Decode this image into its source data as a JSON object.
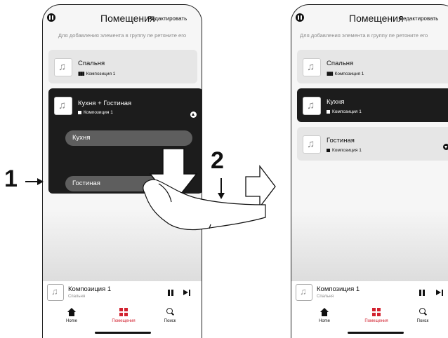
{
  "header": {
    "title": "Помещения",
    "edit": "Редактировать",
    "hint": "Для добавления элемента в группу пе ретяните его"
  },
  "left": {
    "room1": {
      "name": "Спальня",
      "track": "Композиция 1"
    },
    "group": {
      "name": "Кухня + Гостиная",
      "track": "Композиция 1",
      "members": [
        "Кухня",
        "Гостиная"
      ]
    }
  },
  "right": {
    "rooms": [
      {
        "name": "Спальня",
        "track": "Композиция 1"
      },
      {
        "name": "Кухня",
        "track": "Композиция 1"
      },
      {
        "name": "Гостиная",
        "track": "Композиция 1"
      }
    ]
  },
  "player": {
    "title": "Композиция 1",
    "room": "Спальня"
  },
  "tabs": {
    "home": "Home",
    "rooms": "Помещения",
    "search": "Поиск"
  },
  "steps": {
    "one": "1",
    "two": "2"
  },
  "colors": {
    "accent": "#d2212f",
    "dark_card": "#1c1c1c"
  },
  "icons": [
    "app-logo-icon",
    "music-note-icon",
    "equalizer-icon",
    "stop-square-icon",
    "up-arrow-icon",
    "down-arrow-icon",
    "pause-icon",
    "next-track-icon",
    "home-icon",
    "rooms-icon",
    "search-icon",
    "big-down-arrow-icon",
    "outline-right-arrow-icon",
    "hand-icon"
  ]
}
